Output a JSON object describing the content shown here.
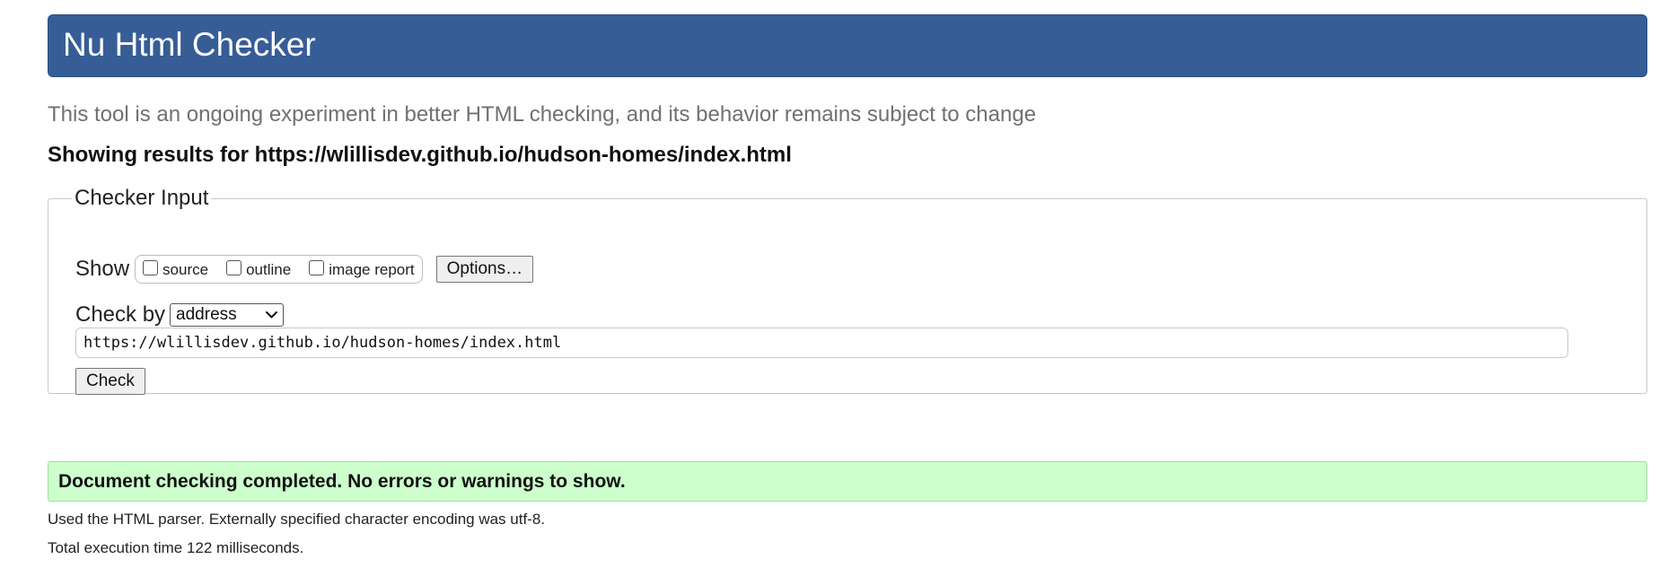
{
  "header": {
    "title": "Nu Html Checker"
  },
  "tagline": "This tool is an ongoing experiment in better HTML checking, and its behavior remains subject to change",
  "results_heading": "Showing results for https://wlillisdev.github.io/hudson-homes/index.html",
  "checker_input": {
    "legend": "Checker Input",
    "show_label": "Show",
    "show_options": [
      {
        "label": "source",
        "checked": false
      },
      {
        "label": "outline",
        "checked": false
      },
      {
        "label": "image report",
        "checked": false
      }
    ],
    "options_button": "Options…",
    "check_by_label": "Check by",
    "check_by_selected": "address",
    "url_value": "https://wlillisdev.github.io/hudson-homes/index.html",
    "check_button": "Check"
  },
  "result": {
    "success_message": "Document checking completed. No errors or warnings to show.",
    "parser_info": "Used the HTML parser. Externally specified character encoding was utf-8.",
    "execution_time": "Total execution time 122 milliseconds."
  },
  "colors": {
    "banner": "#365d96",
    "success_bg": "#ccffcc",
    "tagline_text": "#707070"
  },
  "icons": {
    "select_arrow": "chevron-down-icon"
  }
}
